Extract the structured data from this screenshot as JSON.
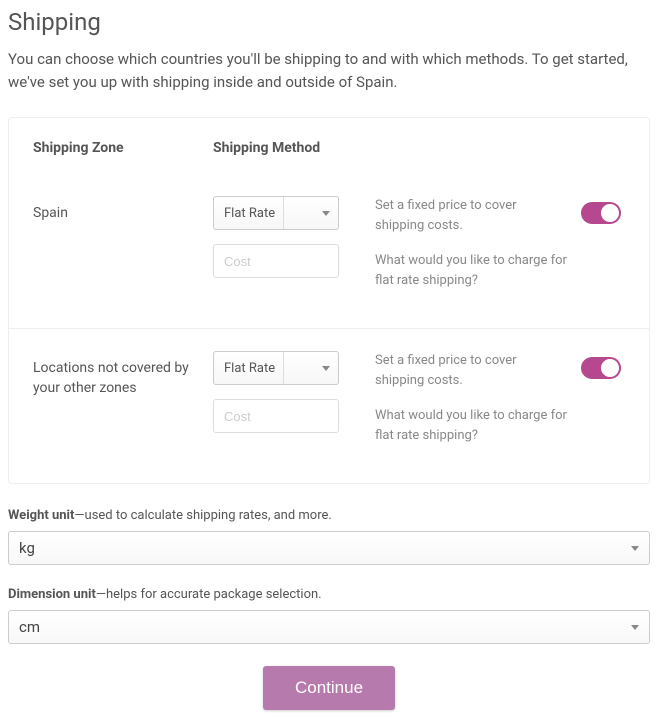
{
  "header": {
    "title": "Shipping",
    "intro": "You can choose which countries you'll be shipping to and with which methods. To get started, we've set you up with shipping inside and outside of Spain."
  },
  "zones": {
    "col_zone": "Shipping Zone",
    "col_method": "Shipping Method",
    "rows": [
      {
        "name": "Spain",
        "method": "Flat Rate",
        "cost_placeholder": "Cost",
        "desc1": "Set a fixed price to cover shipping costs.",
        "desc2": "What would you like to charge for flat rate shipping?",
        "enabled": true
      },
      {
        "name": "Locations not covered by your other zones",
        "method": "Flat Rate",
        "cost_placeholder": "Cost",
        "desc1": "Set a fixed price to cover shipping costs.",
        "desc2": "What would you like to charge for flat rate shipping?",
        "enabled": true
      }
    ]
  },
  "weight": {
    "label_bold": "Weight unit",
    "label_rest": "—used to calculate shipping rates, and more.",
    "value": "kg"
  },
  "dimension": {
    "label_bold": "Dimension unit",
    "label_rest": "—helps for accurate package selection.",
    "value": "cm"
  },
  "actions": {
    "continue": "Continue"
  }
}
